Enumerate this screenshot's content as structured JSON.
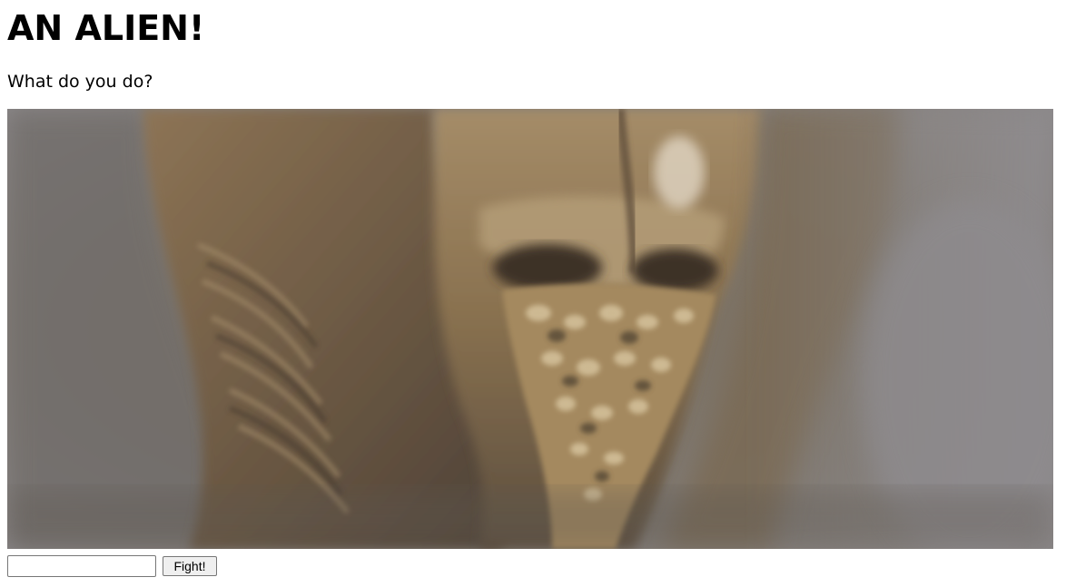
{
  "header": {
    "title": "AN ALIEN!",
    "prompt": "What do you do?"
  },
  "scene": {
    "image_subject": "alien-creature-closeup",
    "colors": {
      "background_mist": "#8a8686",
      "skin_dark": "#5e4d38",
      "skin_mid": "#8a7355",
      "skin_light": "#b7a07a",
      "highlight": "#e6dccb"
    }
  },
  "controls": {
    "input_value": "",
    "input_placeholder": "",
    "fight_label": "Fight!"
  }
}
